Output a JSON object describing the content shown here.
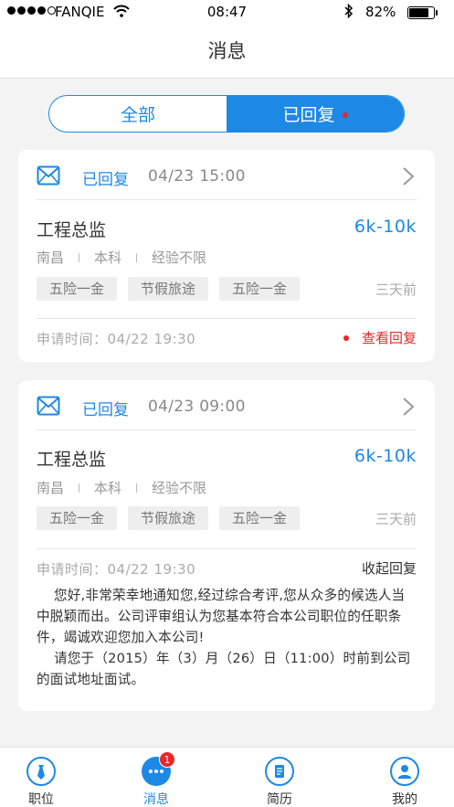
{
  "status_bar": {
    "carrier": "FANQIE",
    "time": "08:47",
    "battery": "82%",
    "battery_level": 0.82
  },
  "nav": {
    "title": "消息"
  },
  "segment": {
    "tabs": [
      {
        "label": "全部",
        "selected": false
      },
      {
        "label": "已回复",
        "selected": true,
        "has_dot": true
      }
    ]
  },
  "cards": [
    {
      "status": "已回复",
      "date": "04/23 15:00",
      "job_title": "工程总监",
      "salary": "6k-10k",
      "location": "南昌",
      "education": "本科",
      "experience": "经验不限",
      "tags": [
        "五险一金",
        "节假旅途",
        "五险一金"
      ],
      "posted": "三天前",
      "apply_time": "申请时间：04/22 19:30",
      "action": "查看回复"
    },
    {
      "status": "已回复",
      "date": "04/23 09:00",
      "job_title": "工程总监",
      "salary": "6k-10k",
      "location": "南昌",
      "education": "本科",
      "experience": "经验不限",
      "tags": [
        "五险一金",
        "节假旅途",
        "五险一金"
      ],
      "posted": "三天前",
      "apply_time": "申请时间：04/22 19:30",
      "action": "收起回复",
      "reply_p1": "您好,非常荣幸地通知您,经过综合考评,您从众多的候选人当中脱颖而出。公司评审组认为您基本符合本公司职位的任职条件，竭诚欢迎您加入本公司!",
      "reply_p2": "请您于（2015）年（3）月（26）日（11:00）时前到公司的面试地址面试。"
    }
  ],
  "tab_bar": {
    "items": [
      {
        "label": "职位",
        "icon": "tie-icon"
      },
      {
        "label": "消息",
        "icon": "chat-bubble-icon",
        "badge": "1",
        "active": true
      },
      {
        "label": "简历",
        "icon": "resume-icon"
      },
      {
        "label": "我的",
        "icon": "person-icon"
      }
    ]
  },
  "colors": {
    "accent": "#1e88e5",
    "alert": "#e8262b"
  }
}
